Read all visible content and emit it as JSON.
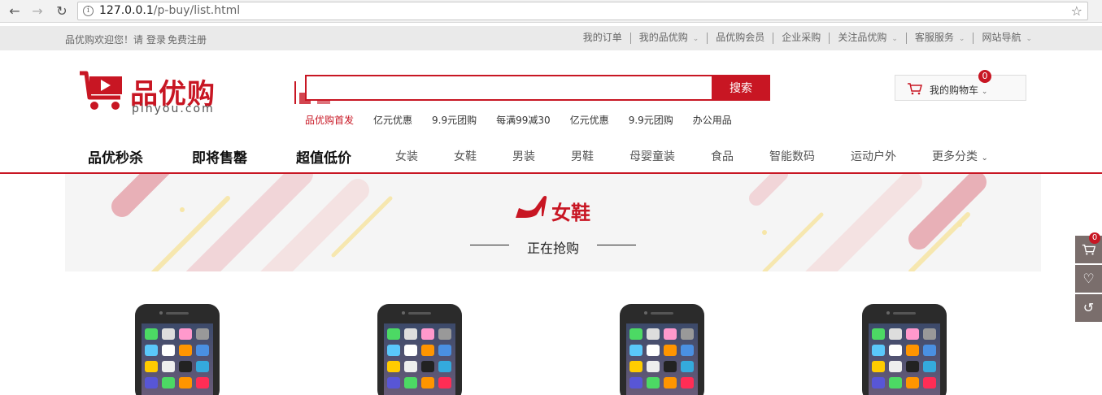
{
  "browser": {
    "url_host": "127.0.0.1",
    "url_path": "/p-buy/list.html"
  },
  "shortcut": {
    "welcome": "品优购欢迎您！请",
    "login": "登录",
    "register": "免费注册",
    "links": [
      {
        "label": "我的订单",
        "has_arrow": false
      },
      {
        "label": "我的品优购",
        "has_arrow": true
      },
      {
        "label": "品优购会员",
        "has_arrow": false
      },
      {
        "label": "企业采购",
        "has_arrow": false
      },
      {
        "label": "关注品优购",
        "has_arrow": true
      },
      {
        "label": "客服服务",
        "has_arrow": true
      },
      {
        "label": "网站导航",
        "has_arrow": true
      }
    ]
  },
  "logo": {
    "cn": "品优购",
    "en": "pinyou.com"
  },
  "search": {
    "value": "",
    "button": "搜索",
    "hotwords": [
      "品优购首发",
      "亿元优惠",
      "9.9元团购",
      "每满99减30",
      "亿元优惠",
      "9.9元团购",
      "办公用品"
    ]
  },
  "cart": {
    "label": "我的购物车",
    "count": "0"
  },
  "nav": {
    "featured": [
      "品优秒杀",
      "即将售罄",
      "超值低价"
    ],
    "categories": [
      "女装",
      "女鞋",
      "男装",
      "男鞋",
      "母婴童装",
      "食品",
      "智能数码",
      "运动户外",
      "更多分类"
    ]
  },
  "banner": {
    "title": "女鞋",
    "subtitle": "正在抢购"
  },
  "sidebar": {
    "cart_count": "0"
  },
  "colors": {
    "brand": "#c81623"
  }
}
